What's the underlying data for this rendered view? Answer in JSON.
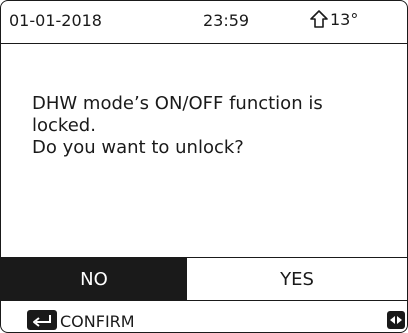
{
  "status_bar": {
    "date": "01-01-2018",
    "time": "23:59",
    "outdoor_temp": "13°",
    "home_icon": "home-outline-icon"
  },
  "dialog": {
    "message": "DHW mode’s ON/OFF function is\nlocked.\nDo you want to unlock?",
    "options": {
      "no": "NO",
      "yes": "YES"
    },
    "selected": "NO"
  },
  "footer": {
    "enter_icon": "enter-key-icon",
    "confirm_label": "CONFIRM",
    "nav_icon": "left-right-arrows-icon"
  },
  "colors": {
    "foreground": "#1a1a1a",
    "background": "#ffffff"
  }
}
